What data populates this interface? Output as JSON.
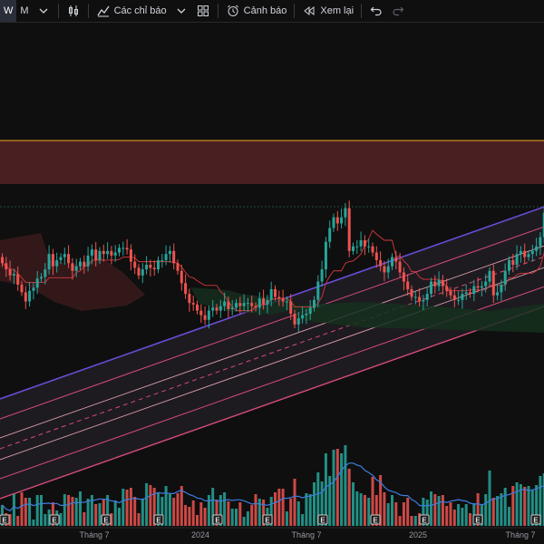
{
  "toolbar": {
    "intervals": [
      "W",
      "M"
    ],
    "active_interval": "W",
    "indicators_label": "Các chỉ báo",
    "alerts_label": "Cảnh báo",
    "replay_label": "Xem lại",
    "icons": [
      "chevron-down-icon",
      "candles-icon",
      "indicators-icon",
      "chevron-down-icon",
      "templates-icon",
      "alert-clock-icon",
      "replay-icon",
      "undo-icon",
      "redo-icon"
    ]
  },
  "colors": {
    "up": "#26a69a",
    "down": "#ef5350",
    "background": "#0f0f0f",
    "resistance_zone": "#4a1f22",
    "resistance_line": "#c88a1c",
    "channel_outer": "#6a4cd8",
    "channel_line": "#d64a7a",
    "cloud_red": "#3a1a1c",
    "cloud_green": "#15301e",
    "ma_line": "#3d7de0"
  },
  "time_axis": [
    "Tháng 7",
    "2024",
    "Tháng 7",
    "2025",
    "Tháng 7"
  ],
  "earnings_marker": "E",
  "chart_data": {
    "type": "candlestick",
    "close_values": [
      20.0,
      19.6,
      19.2,
      19.3,
      18.6,
      18.1,
      17.5,
      18.2,
      18.4,
      19.0,
      19.1,
      19.6,
      20.6,
      19.8,
      20.2,
      20.4,
      20.6,
      20.0,
      19.5,
      19.8,
      20.1,
      19.8,
      20.5,
      20.9,
      20.2,
      20.8,
      20.6,
      20.8,
      20.5,
      20.7,
      21.0,
      21.0,
      20.9,
      20.1,
      19.7,
      19.2,
      19.6,
      19.9,
      19.7,
      19.6,
      20.2,
      20.2,
      20.6,
      20.8,
      20.0,
      19.5,
      18.7,
      18.0,
      17.4,
      17.3,
      16.9,
      16.6,
      16.3,
      16.9,
      17.1,
      16.9,
      17.2,
      17.5,
      17.0,
      17.1,
      17.4,
      17.2,
      17.4,
      17.4,
      17.2,
      17.1,
      17.7,
      17.3,
      17.6,
      18.3,
      17.8,
      17.7,
      17.5,
      17.5,
      16.7,
      16.0,
      16.4,
      16.6,
      16.7,
      17.1,
      17.6,
      18.8,
      19.6,
      21.4,
      22.3,
      23.0,
      22.6,
      23.0,
      23.6,
      20.8,
      21.1,
      21.1,
      21.5,
      21.1,
      21.1,
      20.7,
      20.2,
      19.8,
      19.4,
      19.8,
      20.4,
      20.1,
      19.4,
      18.8,
      18.3,
      17.8,
      17.8,
      17.5,
      17.6,
      18.0,
      18.8,
      18.5,
      18.9,
      18.5,
      18.2,
      17.9,
      17.6,
      17.6,
      18.0,
      18.1,
      18.0,
      18.5,
      18.4,
      18.5,
      18.8,
      19.5,
      17.9,
      18.1,
      18.6,
      19.5,
      20.2,
      19.9,
      20.6,
      20.8,
      20.4,
      20.6,
      20.8,
      21.1,
      21.7,
      23.3,
      24.5
    ],
    "volume": [
      23,
      14,
      13,
      35,
      11,
      37,
      31,
      31,
      7,
      34,
      34,
      13,
      18,
      26,
      17,
      14,
      35,
      34,
      32,
      31,
      38,
      15,
      30,
      34,
      24,
      25,
      30,
      34,
      14,
      28,
      20,
      41,
      40,
      42,
      32,
      14,
      29,
      47,
      45,
      42,
      36,
      32,
      44,
      36,
      31,
      36,
      44,
      23,
      21,
      28,
      12,
      26,
      20,
      34,
      42,
      29,
      34,
      37,
      27,
      19,
      19,
      26,
      10,
      16,
      23,
      35,
      30,
      29,
      20,
      32,
      37,
      41,
      41,
      16,
      30,
      52,
      27,
      13,
      36,
      35,
      48,
      59,
      49,
      80,
      55,
      84,
      85,
      80,
      89,
      63,
      48,
      38,
      36,
      34,
      31,
      54,
      34,
      56,
      37,
      25,
      34,
      26,
      11,
      26,
      31,
      11,
      11,
      14,
      31,
      29,
      38,
      35,
      33,
      34,
      22,
      26,
      18,
      24,
      20,
      24,
      14,
      25,
      36,
      24,
      35,
      61,
      31,
      33,
      36,
      42,
      21,
      44,
      48,
      46,
      43,
      44,
      40,
      45,
      55,
      58,
      63
    ]
  }
}
